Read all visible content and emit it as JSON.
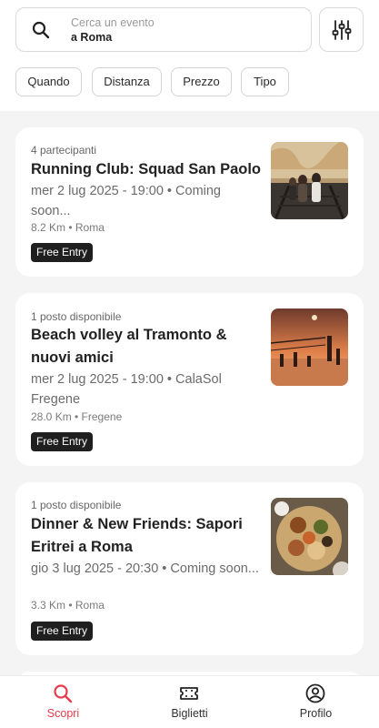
{
  "search": {
    "placeholder": "Cerca un evento",
    "location": "a Roma"
  },
  "filters": [
    {
      "label": "Quando"
    },
    {
      "label": "Distanza"
    },
    {
      "label": "Prezzo"
    },
    {
      "label": "Tipo"
    }
  ],
  "events": [
    {
      "availability": "4 partecipanti",
      "title": "Running Club: Squad San Paolo",
      "when": "mer 2 lug 2025 - 19:00 • Coming soon...",
      "place": "8.2 Km • Roma",
      "badge": "Free Entry",
      "image": "runners-on-bridge"
    },
    {
      "availability": "1 posto disponibile",
      "title": "Beach volley al Tramonto & nuovi amici",
      "when": "mer 2 lug 2025 - 19:00 • CalaSol Fregene",
      "place": "28.0 Km • Fregene",
      "badge": "Free Entry",
      "image": "beach-volley-sunset"
    },
    {
      "availability": "1 posto disponibile",
      "title": "Dinner & New Friends: Sapori Eritrei a Roma",
      "when": "gio 3 lug 2025 - 20:30 • Coming soon...",
      "place": "3.3 Km • Roma",
      "badge": "Free Entry",
      "image": "eritrean-food-platter"
    }
  ],
  "tabbar": {
    "items": [
      {
        "label": "Scopri",
        "icon": "search-icon",
        "active": true
      },
      {
        "label": "Biglietti",
        "icon": "ticket-icon",
        "active": false
      },
      {
        "label": "Profilo",
        "icon": "profile-icon",
        "active": false
      }
    ]
  },
  "colors": {
    "accent": "#e63b4b",
    "badge_bg": "#1f1f1f",
    "page_bg": "#f4f4f4"
  }
}
